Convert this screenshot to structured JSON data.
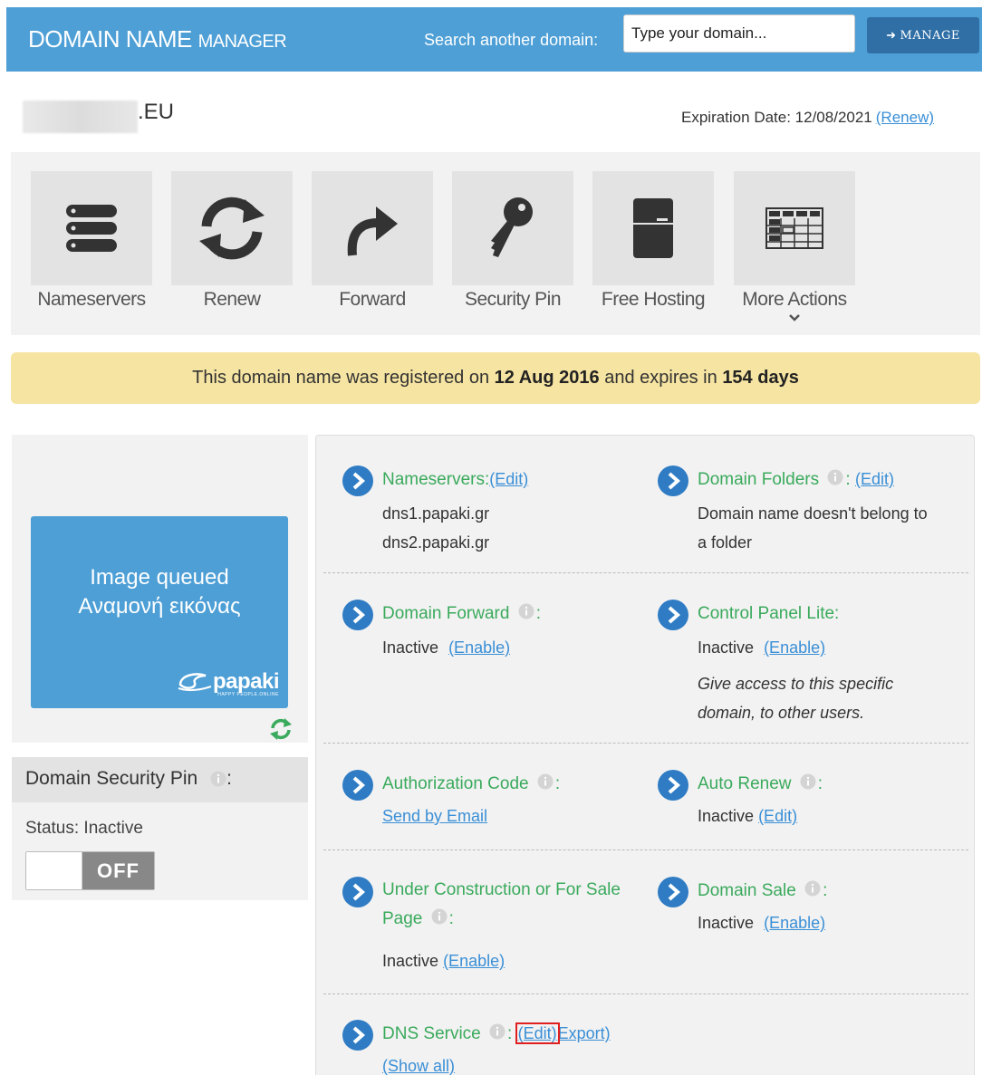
{
  "header": {
    "brand_main": "DOMAIN NAME",
    "brand_sub": "MANAGER",
    "search_label": "Search another domain:",
    "search_placeholder": "Type your domain...",
    "manage_label": "MANAGE"
  },
  "domain": {
    "tld": ".EU",
    "expiry_label": "Expiration Date: 12/08/2021",
    "renew_link": "(Renew)"
  },
  "actions": [
    {
      "label": "Nameservers",
      "icon": "server-icon"
    },
    {
      "label": "Renew",
      "icon": "refresh-icon"
    },
    {
      "label": "Forward",
      "icon": "forward-arrow-icon"
    },
    {
      "label": "Security Pin",
      "icon": "key-icon"
    },
    {
      "label": "Free Hosting",
      "icon": "hosting-box-icon"
    },
    {
      "label": "More Actions",
      "icon": "grid-icon"
    }
  ],
  "notice": {
    "part1": "This domain name was registered on ",
    "registered": "12 Aug 2016",
    "part2": " and expires in ",
    "expires_in": "154 days"
  },
  "thumbnail": {
    "line1": "Image queued",
    "line2": "Αναμονή εικόνας",
    "logo": "papaki",
    "logo_tag": "HAPPY PEOPLE.ONLINE"
  },
  "security_pin": {
    "title": "Domain Security Pin",
    "status": "Status: Inactive",
    "toggle": "OFF"
  },
  "details": {
    "nameservers": {
      "title": "Nameservers:",
      "edit": "(Edit)",
      "values": [
        "dns1.papaki.gr",
        "dns2.papaki.gr"
      ]
    },
    "folders": {
      "title": "Domain Folders",
      "edit": "(Edit)",
      "line1": "Domain name doesn't belong to",
      "line2": "a folder"
    },
    "forward": {
      "title": "Domain Forward",
      "status": "Inactive",
      "action": "(Enable)"
    },
    "cpanel": {
      "title": "Control Panel Lite:",
      "status": "Inactive",
      "action": "(Enable)",
      "desc1": "Give access to this specific",
      "desc2": "domain, to other users."
    },
    "auth": {
      "title": "Authorization Code",
      "action": "Send by Email"
    },
    "autorenew": {
      "title": "Auto Renew",
      "status": "Inactive",
      "action": "(Edit)"
    },
    "construction": {
      "title": "Under Construction or For Sale Page",
      "status": "Inactive",
      "action": "(Enable)"
    },
    "sale": {
      "title": "Domain Sale",
      "status": "Inactive",
      "action": "(Enable)"
    },
    "dns": {
      "title": "DNS Service",
      "edit": "(Edit)",
      "export": "Export)",
      "show_all": "(Show all)"
    }
  },
  "colors": {
    "header": "#4d9fd6",
    "manage_button": "#2f6fa6",
    "notice": "#f6e4a2",
    "green_title": "#3aaa5c",
    "link": "#3a8fd6",
    "highlight": "#e02020"
  }
}
